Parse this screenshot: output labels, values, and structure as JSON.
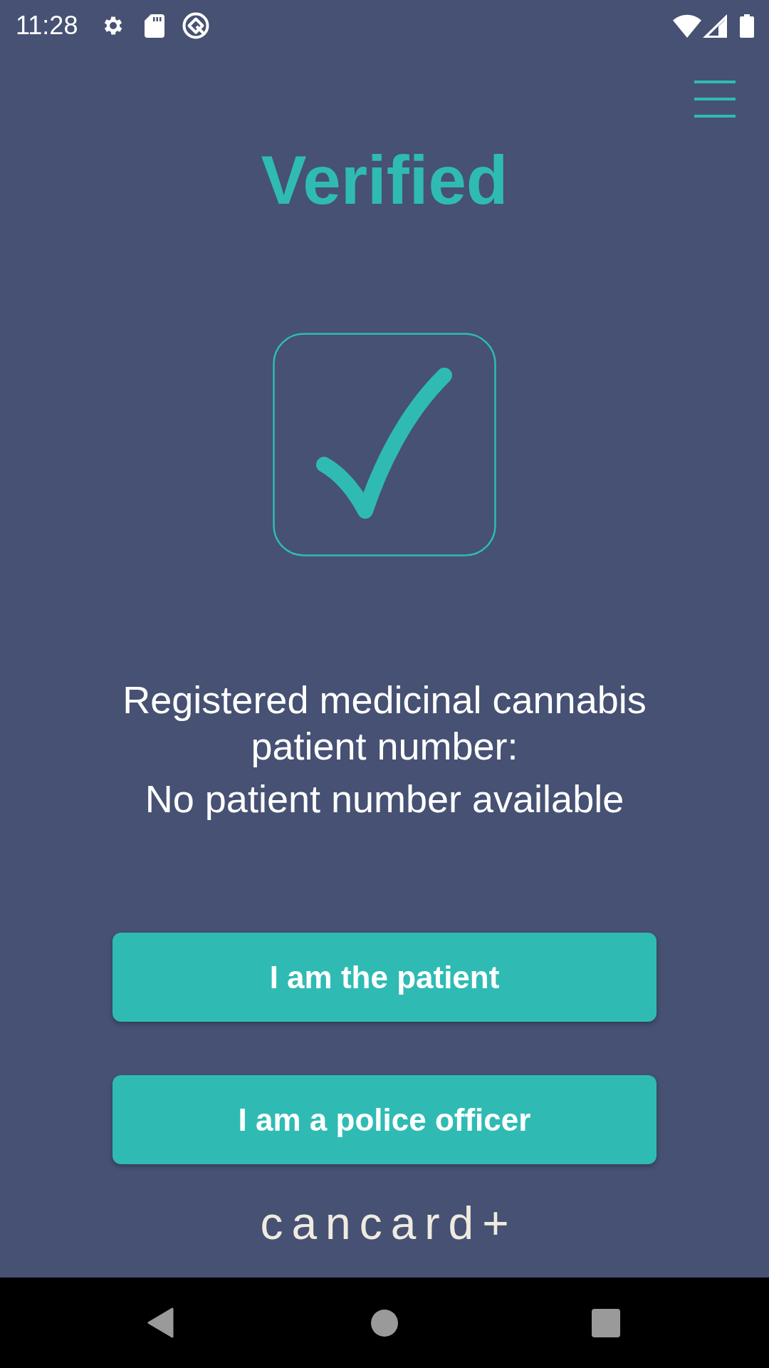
{
  "status_bar": {
    "time": "11:28"
  },
  "header": {
    "title": "Verified"
  },
  "patient": {
    "label": "Registered medicinal cannabis patient number:",
    "value": "No patient number available"
  },
  "buttons": [
    {
      "label": "I am the patient"
    },
    {
      "label": "I am a police officer"
    }
  ],
  "brand": {
    "logo": "cancard+"
  }
}
